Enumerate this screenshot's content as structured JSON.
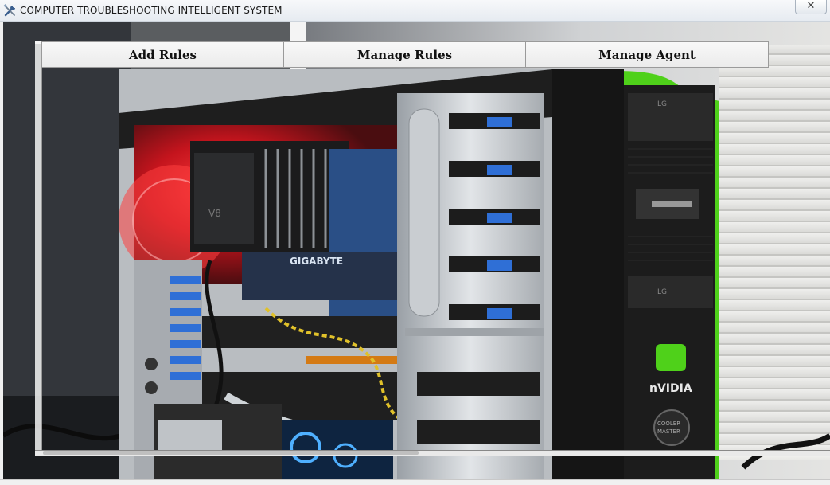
{
  "window": {
    "title": "COMPUTER TROUBLESHOOTING INTELLIGENT SYSTEM",
    "app_icon": "tools-icon",
    "close_label": "✕"
  },
  "menu": {
    "items": [
      {
        "label": "Add Rules"
      },
      {
        "label": "Manage Rules"
      },
      {
        "label": "Manage Agent"
      }
    ]
  },
  "background_image": {
    "subject": "open-pc-case-photo",
    "logos": [
      "GIGABYTE",
      "nVIDIA",
      "COOLER MASTER",
      "LG"
    ]
  },
  "colors": {
    "case_green": "#4fd11a",
    "case_black": "#141414",
    "led_red": "#e0202a",
    "drive_clip_blue": "#2f6fd6"
  }
}
